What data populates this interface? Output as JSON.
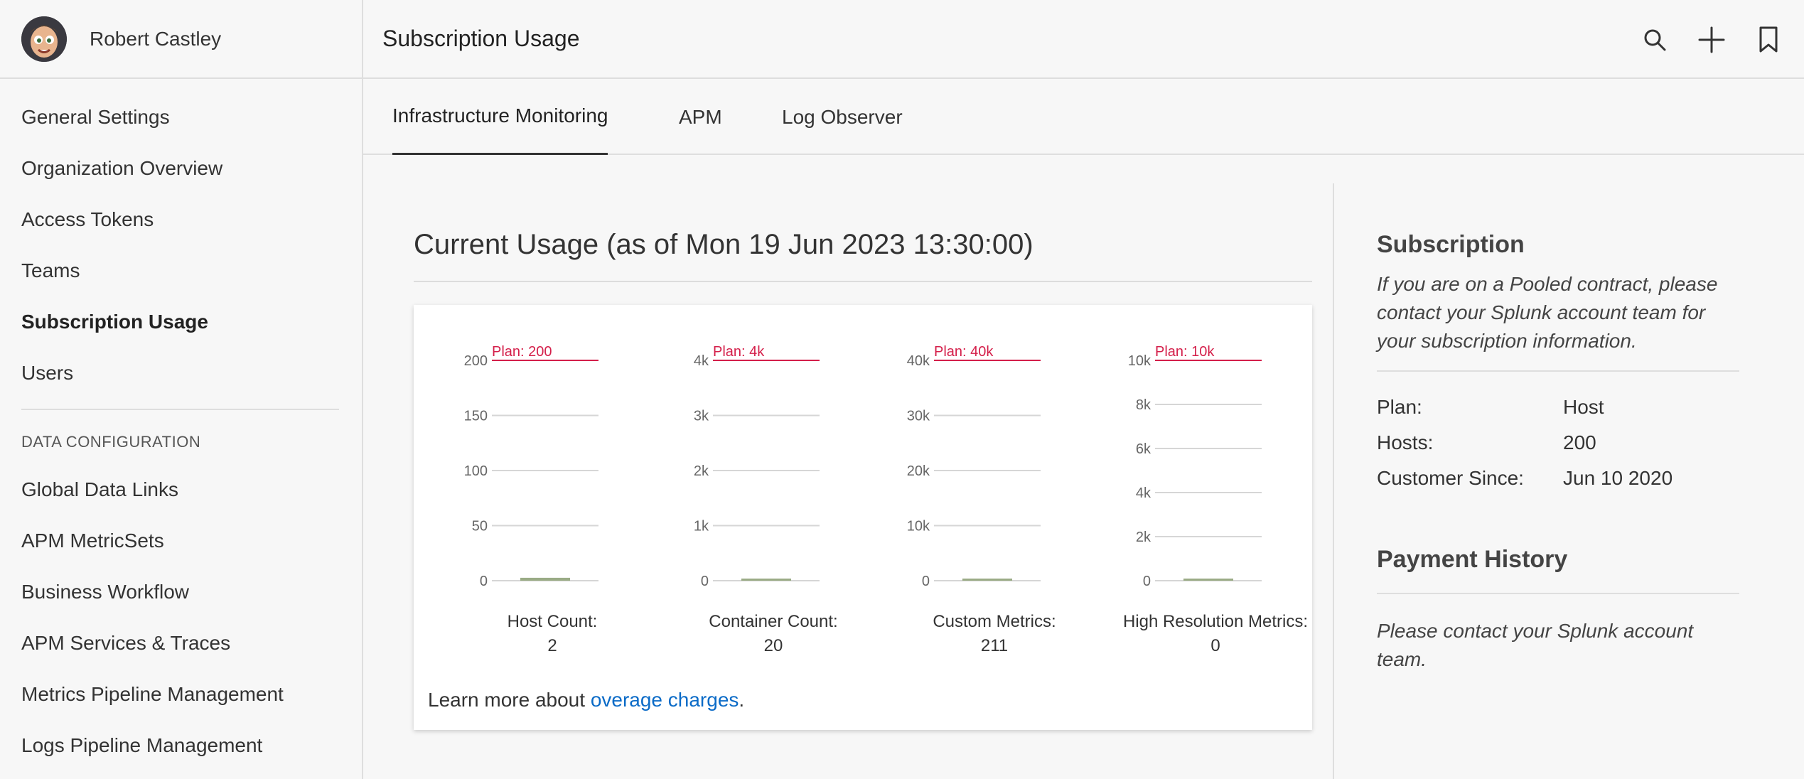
{
  "user": {
    "name": "Robert Castley"
  },
  "header": {
    "title": "Subscription Usage"
  },
  "icons": {
    "search": "search-icon",
    "add": "plus-icon",
    "bookmark": "bookmark-icon"
  },
  "sidebar": {
    "items": [
      {
        "label": "General Settings",
        "active": false
      },
      {
        "label": "Organization Overview",
        "active": false
      },
      {
        "label": "Access Tokens",
        "active": false
      },
      {
        "label": "Teams",
        "active": false
      },
      {
        "label": "Subscription Usage",
        "active": true
      },
      {
        "label": "Users",
        "active": false
      }
    ],
    "section_label": "DATA CONFIGURATION",
    "section_items": [
      {
        "label": "Global Data Links"
      },
      {
        "label": "APM MetricSets"
      },
      {
        "label": "Business Workflow"
      },
      {
        "label": "APM Services & Traces"
      },
      {
        "label": "Metrics Pipeline Management"
      },
      {
        "label": "Logs Pipeline Management"
      }
    ]
  },
  "tabs": [
    {
      "label": "Infrastructure Monitoring",
      "active": true
    },
    {
      "label": "APM",
      "active": false
    },
    {
      "label": "Log Observer",
      "active": false
    }
  ],
  "usage": {
    "title": "Current Usage (as of Mon 19 Jun 2023 13:30:00)",
    "learn_more_prefix": "Learn more about ",
    "learn_more_link": "overage charges",
    "learn_more_suffix": "."
  },
  "colors": {
    "plan_line": "#d41f4a",
    "usage_bar": "#9aab86",
    "gridline": "#d6d6d6",
    "link": "#0b6bc7"
  },
  "chart_data": [
    {
      "type": "bar",
      "categories": [
        "Host Count:"
      ],
      "values": [
        2
      ],
      "value_label": "2",
      "plan_label": "Plan: 200",
      "plan_value": 200,
      "yticks": [
        "0",
        "50",
        "100",
        "150",
        "200"
      ],
      "ytick_values": [
        0,
        50,
        100,
        150,
        200
      ],
      "ylim": [
        0,
        200
      ]
    },
    {
      "type": "bar",
      "categories": [
        "Container Count:"
      ],
      "values": [
        20
      ],
      "value_label": "20",
      "plan_label": "Plan: 4k",
      "plan_value": 4000,
      "yticks": [
        "0",
        "1k",
        "2k",
        "3k",
        "4k"
      ],
      "ytick_values": [
        0,
        1000,
        2000,
        3000,
        4000
      ],
      "ylim": [
        0,
        4000
      ]
    },
    {
      "type": "bar",
      "categories": [
        "Custom Metrics:"
      ],
      "values": [
        211
      ],
      "value_label": "211",
      "plan_label": "Plan: 40k",
      "plan_value": 40000,
      "yticks": [
        "0",
        "10k",
        "20k",
        "30k",
        "40k"
      ],
      "ytick_values": [
        0,
        10000,
        20000,
        30000,
        40000
      ],
      "ylim": [
        0,
        40000
      ]
    },
    {
      "type": "bar",
      "categories": [
        "High Resolution Metrics:"
      ],
      "values": [
        0
      ],
      "value_label": "0",
      "plan_label": "Plan: 10k",
      "plan_value": 10000,
      "yticks": [
        "0",
        "2k",
        "4k",
        "6k",
        "8k",
        "10k"
      ],
      "ytick_values": [
        0,
        2000,
        4000,
        6000,
        8000,
        10000
      ],
      "ylim": [
        0,
        10000
      ]
    }
  ],
  "subscription": {
    "title": "Subscription",
    "note": "If you are on a Pooled contract, please contact your Splunk account team for your subscription information.",
    "rows": [
      {
        "key": "Plan:",
        "value": "Host"
      },
      {
        "key": "Hosts:",
        "value": "200"
      },
      {
        "key": "Customer Since:",
        "value": "Jun 10 2020"
      }
    ]
  },
  "payment": {
    "title": "Payment History",
    "note": "Please contact your Splunk account team."
  }
}
